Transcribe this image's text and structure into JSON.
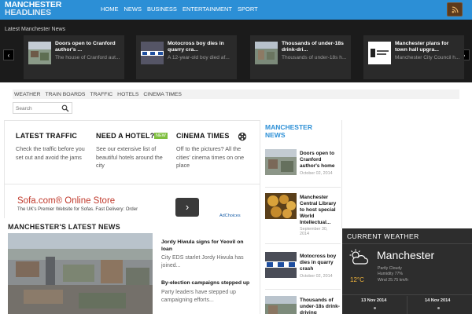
{
  "header": {
    "logo_line1": "MANCHESTER",
    "logo_line2": "HEADLINES",
    "nav": [
      "HOME",
      "NEWS",
      "BUSINESS",
      "ENTERTAINMENT",
      "SPORT"
    ],
    "rss_icon": "rss-icon"
  },
  "ticker": {
    "title": "Latest Manchester News",
    "items": [
      {
        "title": "Doors open to Cranford author's ...",
        "excerpt": "The house of Cranford aut..."
      },
      {
        "title": "Motocross boy dies in quarry cra...",
        "excerpt": "A 12-year-old boy died af..."
      },
      {
        "title": "Thousands of under-18s drink-dri...",
        "excerpt": "Thousands of under-18s h..."
      },
      {
        "title": "Manchester plans for town hall upgra...",
        "excerpt": "Manchester City Council h..."
      }
    ]
  },
  "tabs": [
    "WEATHER",
    "TRAIN BOARDS",
    "TRAFFIC",
    "HOTELS",
    "CINEMA TIMES"
  ],
  "search": {
    "placeholder": "Search"
  },
  "features": [
    {
      "title": "LATEST TRAFFIC",
      "text": "Check the traffic before you set out and avoid the jams"
    },
    {
      "title": "NEED A HOTEL?",
      "text": "See our extensive list of beautiful hotels around the city"
    },
    {
      "title": "CINEMA TIMES",
      "text": "Off to the pictures? All the cities' cinema times on one place"
    }
  ],
  "new_badge": "NEW",
  "ad": {
    "title": "Sofa.com® Online Store",
    "desc": "The UK's Premier Website for Sofas. Fast Delivery: Order",
    "choices": "AdChoices"
  },
  "latest": {
    "title": "MANCHESTER'S LATEST NEWS",
    "items": [
      {
        "title": "Jordy Hiwula signs for Yeovil on loan",
        "text": "City EDS starlet Jordy Hiwula has joined..."
      },
      {
        "title": "By-election campaigns stepped up",
        "text": "Party leaders have stepped up campaigning efforts..."
      }
    ]
  },
  "manchester_news": {
    "title": "MANCHESTER NEWS",
    "items": [
      {
        "title": "Doors open to Cranford author's home",
        "date": "October 02, 2014"
      },
      {
        "title": "Manchester Central Library to host special World Intellectual...",
        "date": "September 30, 2014"
      },
      {
        "title": "Motocross boy dies in quarry crash",
        "date": "October 02, 2014"
      },
      {
        "title": "Thousands of under-18s drink-driving",
        "date": ""
      }
    ]
  },
  "weather": {
    "title": "CURRENT WEATHER",
    "city": "Manchester",
    "temp": "12°C",
    "condition": "Partly Cloudy",
    "humidity": "Humidity 77%",
    "wind": "Wind 25.75 km/h",
    "days": [
      "13 Nov 2014",
      "14 Nov 2014"
    ]
  }
}
